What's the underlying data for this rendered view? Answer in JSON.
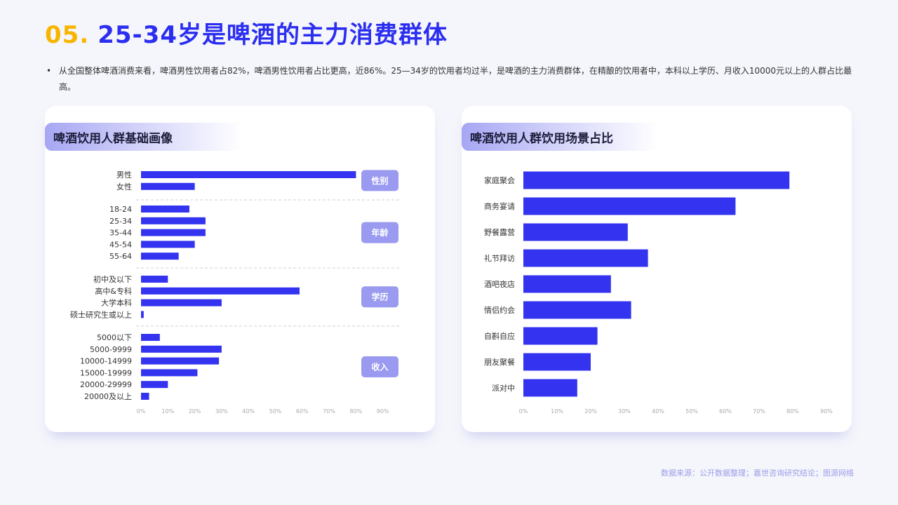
{
  "header": {
    "number": "05.",
    "title": "25-34岁是啤酒的主力消费群体"
  },
  "summary": {
    "bullet": "•",
    "text": "从全国整体啤酒消费来看，啤酒男性饮用者占82%，啤酒男性饮用者占比更高，近86%。25—34岁的饮用者均过半，是啤酒的主力消费群体，在精酿的饮用者中，本科以上学历、月收入10000元以上的人群占比最高。"
  },
  "left_card": {
    "title": "啤酒饮用人群基础画像"
  },
  "right_card": {
    "title": "啤酒饮用人群饮用场景占比"
  },
  "source": "数据来源：公开数据整理；嘉世咨询研究结论；图源网络",
  "colors": {
    "bar": "#3333f0",
    "accent_yellow": "#f7b500",
    "title_blue": "#2b2ef0",
    "tag": "#9a9af0"
  },
  "chart_data": [
    {
      "type": "bar",
      "orientation": "horizontal",
      "title": "啤酒饮用人群基础画像",
      "xlim": [
        0,
        90
      ],
      "xticks": [
        "0%",
        "10%",
        "20%",
        "30%",
        "40%",
        "50%",
        "60%",
        "70%",
        "80%",
        "90%"
      ],
      "groups": [
        {
          "tag": "性别",
          "categories": [
            "男性",
            "女性"
          ],
          "values": [
            80,
            20
          ]
        },
        {
          "tag": "年龄",
          "categories": [
            "18-24",
            "25-34",
            "35-44",
            "45-54",
            "55-64"
          ],
          "values": [
            18,
            24,
            24,
            20,
            14
          ]
        },
        {
          "tag": "学历",
          "categories": [
            "初中及以下",
            "高中&专科",
            "大学本科",
            "硕士研究生或以上"
          ],
          "values": [
            10,
            59,
            30,
            1
          ]
        },
        {
          "tag": "收入",
          "categories": [
            "5000以下",
            "5000-9999",
            "10000-14999",
            "15000-19999",
            "20000-29999",
            "20000及以上"
          ],
          "values": [
            7,
            30,
            29,
            21,
            10,
            3
          ]
        }
      ]
    },
    {
      "type": "bar",
      "orientation": "horizontal",
      "title": "啤酒饮用人群饮用场景占比",
      "xlim": [
        0,
        90
      ],
      "xticks": [
        "0%",
        "10%",
        "20%",
        "30%",
        "40%",
        "50%",
        "60%",
        "70%",
        "80%",
        "90%"
      ],
      "categories": [
        "家庭聚会",
        "商务宴请",
        "野餐露营",
        "礼节拜访",
        "酒吧夜店",
        "情侣约会",
        "自斟自应",
        "朋友聚餐",
        "派对中"
      ],
      "values": [
        79,
        63,
        31,
        37,
        26,
        32,
        22,
        20,
        16
      ]
    }
  ]
}
